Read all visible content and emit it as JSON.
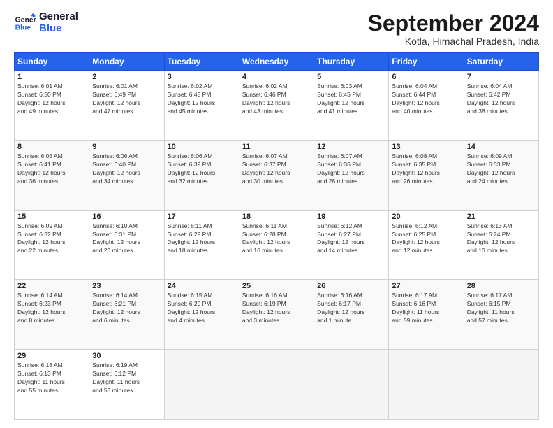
{
  "header": {
    "logo_line1": "General",
    "logo_line2": "Blue",
    "month": "September 2024",
    "location": "Kotla, Himachal Pradesh, India"
  },
  "weekdays": [
    "Sunday",
    "Monday",
    "Tuesday",
    "Wednesday",
    "Thursday",
    "Friday",
    "Saturday"
  ],
  "weeks": [
    [
      {
        "day": "1",
        "info": "Sunrise: 6:01 AM\nSunset: 6:50 PM\nDaylight: 12 hours\nand 49 minutes."
      },
      {
        "day": "2",
        "info": "Sunrise: 6:01 AM\nSunset: 6:49 PM\nDaylight: 12 hours\nand 47 minutes."
      },
      {
        "day": "3",
        "info": "Sunrise: 6:02 AM\nSunset: 6:48 PM\nDaylight: 12 hours\nand 45 minutes."
      },
      {
        "day": "4",
        "info": "Sunrise: 6:02 AM\nSunset: 6:46 PM\nDaylight: 12 hours\nand 43 minutes."
      },
      {
        "day": "5",
        "info": "Sunrise: 6:03 AM\nSunset: 6:45 PM\nDaylight: 12 hours\nand 41 minutes."
      },
      {
        "day": "6",
        "info": "Sunrise: 6:04 AM\nSunset: 6:44 PM\nDaylight: 12 hours\nand 40 minutes."
      },
      {
        "day": "7",
        "info": "Sunrise: 6:04 AM\nSunset: 6:42 PM\nDaylight: 12 hours\nand 38 minutes."
      }
    ],
    [
      {
        "day": "8",
        "info": "Sunrise: 6:05 AM\nSunset: 6:41 PM\nDaylight: 12 hours\nand 36 minutes."
      },
      {
        "day": "9",
        "info": "Sunrise: 6:06 AM\nSunset: 6:40 PM\nDaylight: 12 hours\nand 34 minutes."
      },
      {
        "day": "10",
        "info": "Sunrise: 6:06 AM\nSunset: 6:39 PM\nDaylight: 12 hours\nand 32 minutes."
      },
      {
        "day": "11",
        "info": "Sunrise: 6:07 AM\nSunset: 6:37 PM\nDaylight: 12 hours\nand 30 minutes."
      },
      {
        "day": "12",
        "info": "Sunrise: 6:07 AM\nSunset: 6:36 PM\nDaylight: 12 hours\nand 28 minutes."
      },
      {
        "day": "13",
        "info": "Sunrise: 6:08 AM\nSunset: 6:35 PM\nDaylight: 12 hours\nand 26 minutes."
      },
      {
        "day": "14",
        "info": "Sunrise: 6:09 AM\nSunset: 6:33 PM\nDaylight: 12 hours\nand 24 minutes."
      }
    ],
    [
      {
        "day": "15",
        "info": "Sunrise: 6:09 AM\nSunset: 6:32 PM\nDaylight: 12 hours\nand 22 minutes."
      },
      {
        "day": "16",
        "info": "Sunrise: 6:10 AM\nSunset: 6:31 PM\nDaylight: 12 hours\nand 20 minutes."
      },
      {
        "day": "17",
        "info": "Sunrise: 6:11 AM\nSunset: 6:29 PM\nDaylight: 12 hours\nand 18 minutes."
      },
      {
        "day": "18",
        "info": "Sunrise: 6:11 AM\nSunset: 6:28 PM\nDaylight: 12 hours\nand 16 minutes."
      },
      {
        "day": "19",
        "info": "Sunrise: 6:12 AM\nSunset: 6:27 PM\nDaylight: 12 hours\nand 14 minutes."
      },
      {
        "day": "20",
        "info": "Sunrise: 6:12 AM\nSunset: 6:25 PM\nDaylight: 12 hours\nand 12 minutes."
      },
      {
        "day": "21",
        "info": "Sunrise: 6:13 AM\nSunset: 6:24 PM\nDaylight: 12 hours\nand 10 minutes."
      }
    ],
    [
      {
        "day": "22",
        "info": "Sunrise: 6:14 AM\nSunset: 6:23 PM\nDaylight: 12 hours\nand 8 minutes."
      },
      {
        "day": "23",
        "info": "Sunrise: 6:14 AM\nSunset: 6:21 PM\nDaylight: 12 hours\nand 6 minutes."
      },
      {
        "day": "24",
        "info": "Sunrise: 6:15 AM\nSunset: 6:20 PM\nDaylight: 12 hours\nand 4 minutes."
      },
      {
        "day": "25",
        "info": "Sunrise: 6:16 AM\nSunset: 6:19 PM\nDaylight: 12 hours\nand 3 minutes."
      },
      {
        "day": "26",
        "info": "Sunrise: 6:16 AM\nSunset: 6:17 PM\nDaylight: 12 hours\nand 1 minute."
      },
      {
        "day": "27",
        "info": "Sunrise: 6:17 AM\nSunset: 6:16 PM\nDaylight: 11 hours\nand 59 minutes."
      },
      {
        "day": "28",
        "info": "Sunrise: 6:17 AM\nSunset: 6:15 PM\nDaylight: 11 hours\nand 57 minutes."
      }
    ],
    [
      {
        "day": "29",
        "info": "Sunrise: 6:18 AM\nSunset: 6:13 PM\nDaylight: 11 hours\nand 55 minutes."
      },
      {
        "day": "30",
        "info": "Sunrise: 6:19 AM\nSunset: 6:12 PM\nDaylight: 11 hours\nand 53 minutes."
      },
      {
        "day": "",
        "info": ""
      },
      {
        "day": "",
        "info": ""
      },
      {
        "day": "",
        "info": ""
      },
      {
        "day": "",
        "info": ""
      },
      {
        "day": "",
        "info": ""
      }
    ]
  ]
}
